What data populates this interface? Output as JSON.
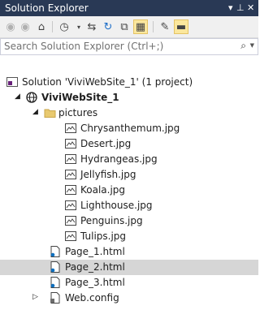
{
  "window": {
    "title": "Solution Explorer",
    "pin_glyph": "▾ ⊥ ✕"
  },
  "search": {
    "placeholder": "Search Solution Explorer (Ctrl+;)"
  },
  "toolbar": [
    "back-icon",
    "forward-icon",
    "home-icon",
    "history-icon",
    "sync-icon",
    "refresh-icon",
    "collapse-icon",
    "show-all-files-icon",
    "properties-icon",
    "preview-icon"
  ],
  "tree": [
    {
      "label": "Solution 'ViviWebSite_1' (1 project)",
      "icon": "solution-icon",
      "level": 0
    },
    {
      "label": "ViviWebSite_1",
      "icon": "website-icon",
      "level": 1,
      "expanded": true,
      "bold": true
    },
    {
      "label": "pictures",
      "icon": "folder-icon",
      "level": 2,
      "expanded": true
    },
    {
      "label": "Chrysanthemum.jpg",
      "icon": "image-file-icon",
      "level": 3
    },
    {
      "label": "Desert.jpg",
      "icon": "image-file-icon",
      "level": 3
    },
    {
      "label": "Hydrangeas.jpg",
      "icon": "image-file-icon",
      "level": 3
    },
    {
      "label": "Jellyfish.jpg",
      "icon": "image-file-icon",
      "level": 3
    },
    {
      "label": "Koala.jpg",
      "icon": "image-file-icon",
      "level": 3
    },
    {
      "label": "Lighthouse.jpg",
      "icon": "image-file-icon",
      "level": 3
    },
    {
      "label": "Penguins.jpg",
      "icon": "image-file-icon",
      "level": 3
    },
    {
      "label": "Tulips.jpg",
      "icon": "image-file-icon",
      "level": 3
    },
    {
      "label": "Page_1.html",
      "icon": "html-file-icon",
      "level": 2
    },
    {
      "label": "Page_2.html",
      "icon": "html-file-icon",
      "level": 2,
      "selected": true
    },
    {
      "label": "Page_3.html",
      "icon": "html-file-icon",
      "level": 2
    },
    {
      "label": "Web.config",
      "icon": "config-file-icon",
      "level": 2,
      "expanded": false
    }
  ],
  "colors": {
    "titlebar": "#293955",
    "selection": "#d6d6d6",
    "folder": "#e8c96f",
    "accent": "#0e70c0"
  }
}
